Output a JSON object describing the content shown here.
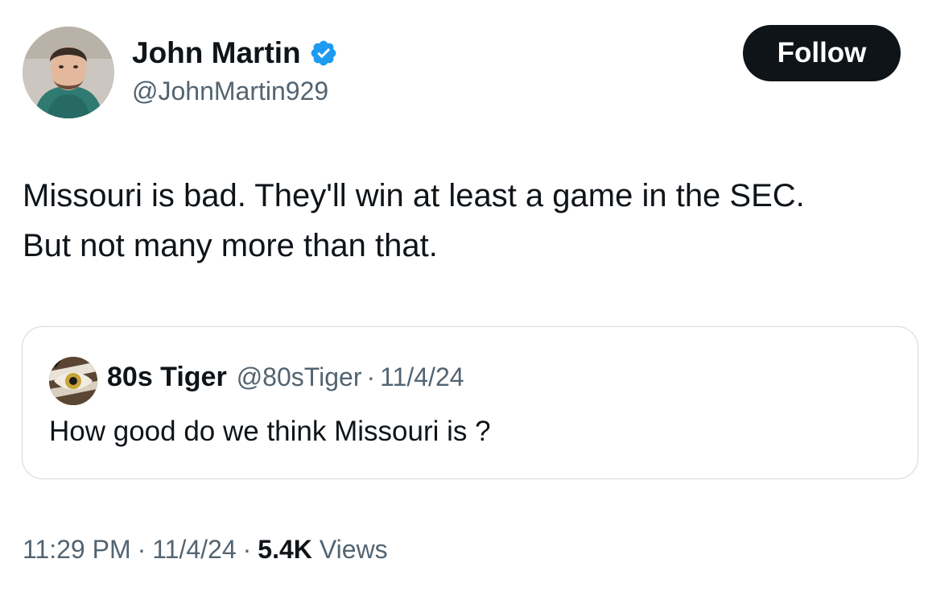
{
  "author": {
    "display_name": "John Martin",
    "handle": "@JohnMartin929",
    "verified_icon": "verified-badge-icon",
    "verified_color": "#1d9bf0"
  },
  "follow_button": {
    "label": "Follow",
    "background": "#0f1419",
    "text_color": "#ffffff"
  },
  "tweet": {
    "lines": [
      "Missouri is bad. They'll win at least a game in the SEC.",
      "But not many more than that."
    ]
  },
  "quoted_tweet": {
    "display_name": "80s Tiger",
    "handle": "@80sTiger",
    "separator": "·",
    "date": "11/4/24",
    "text": "How good do we think Missouri is ?"
  },
  "meta": {
    "time": "11:29 PM",
    "separator": "·",
    "date": "11/4/24",
    "views_count": "5.4K",
    "views_label": "Views"
  },
  "colors": {
    "text_primary": "#0f1419",
    "text_secondary": "#536471",
    "border": "#cfd9de"
  }
}
